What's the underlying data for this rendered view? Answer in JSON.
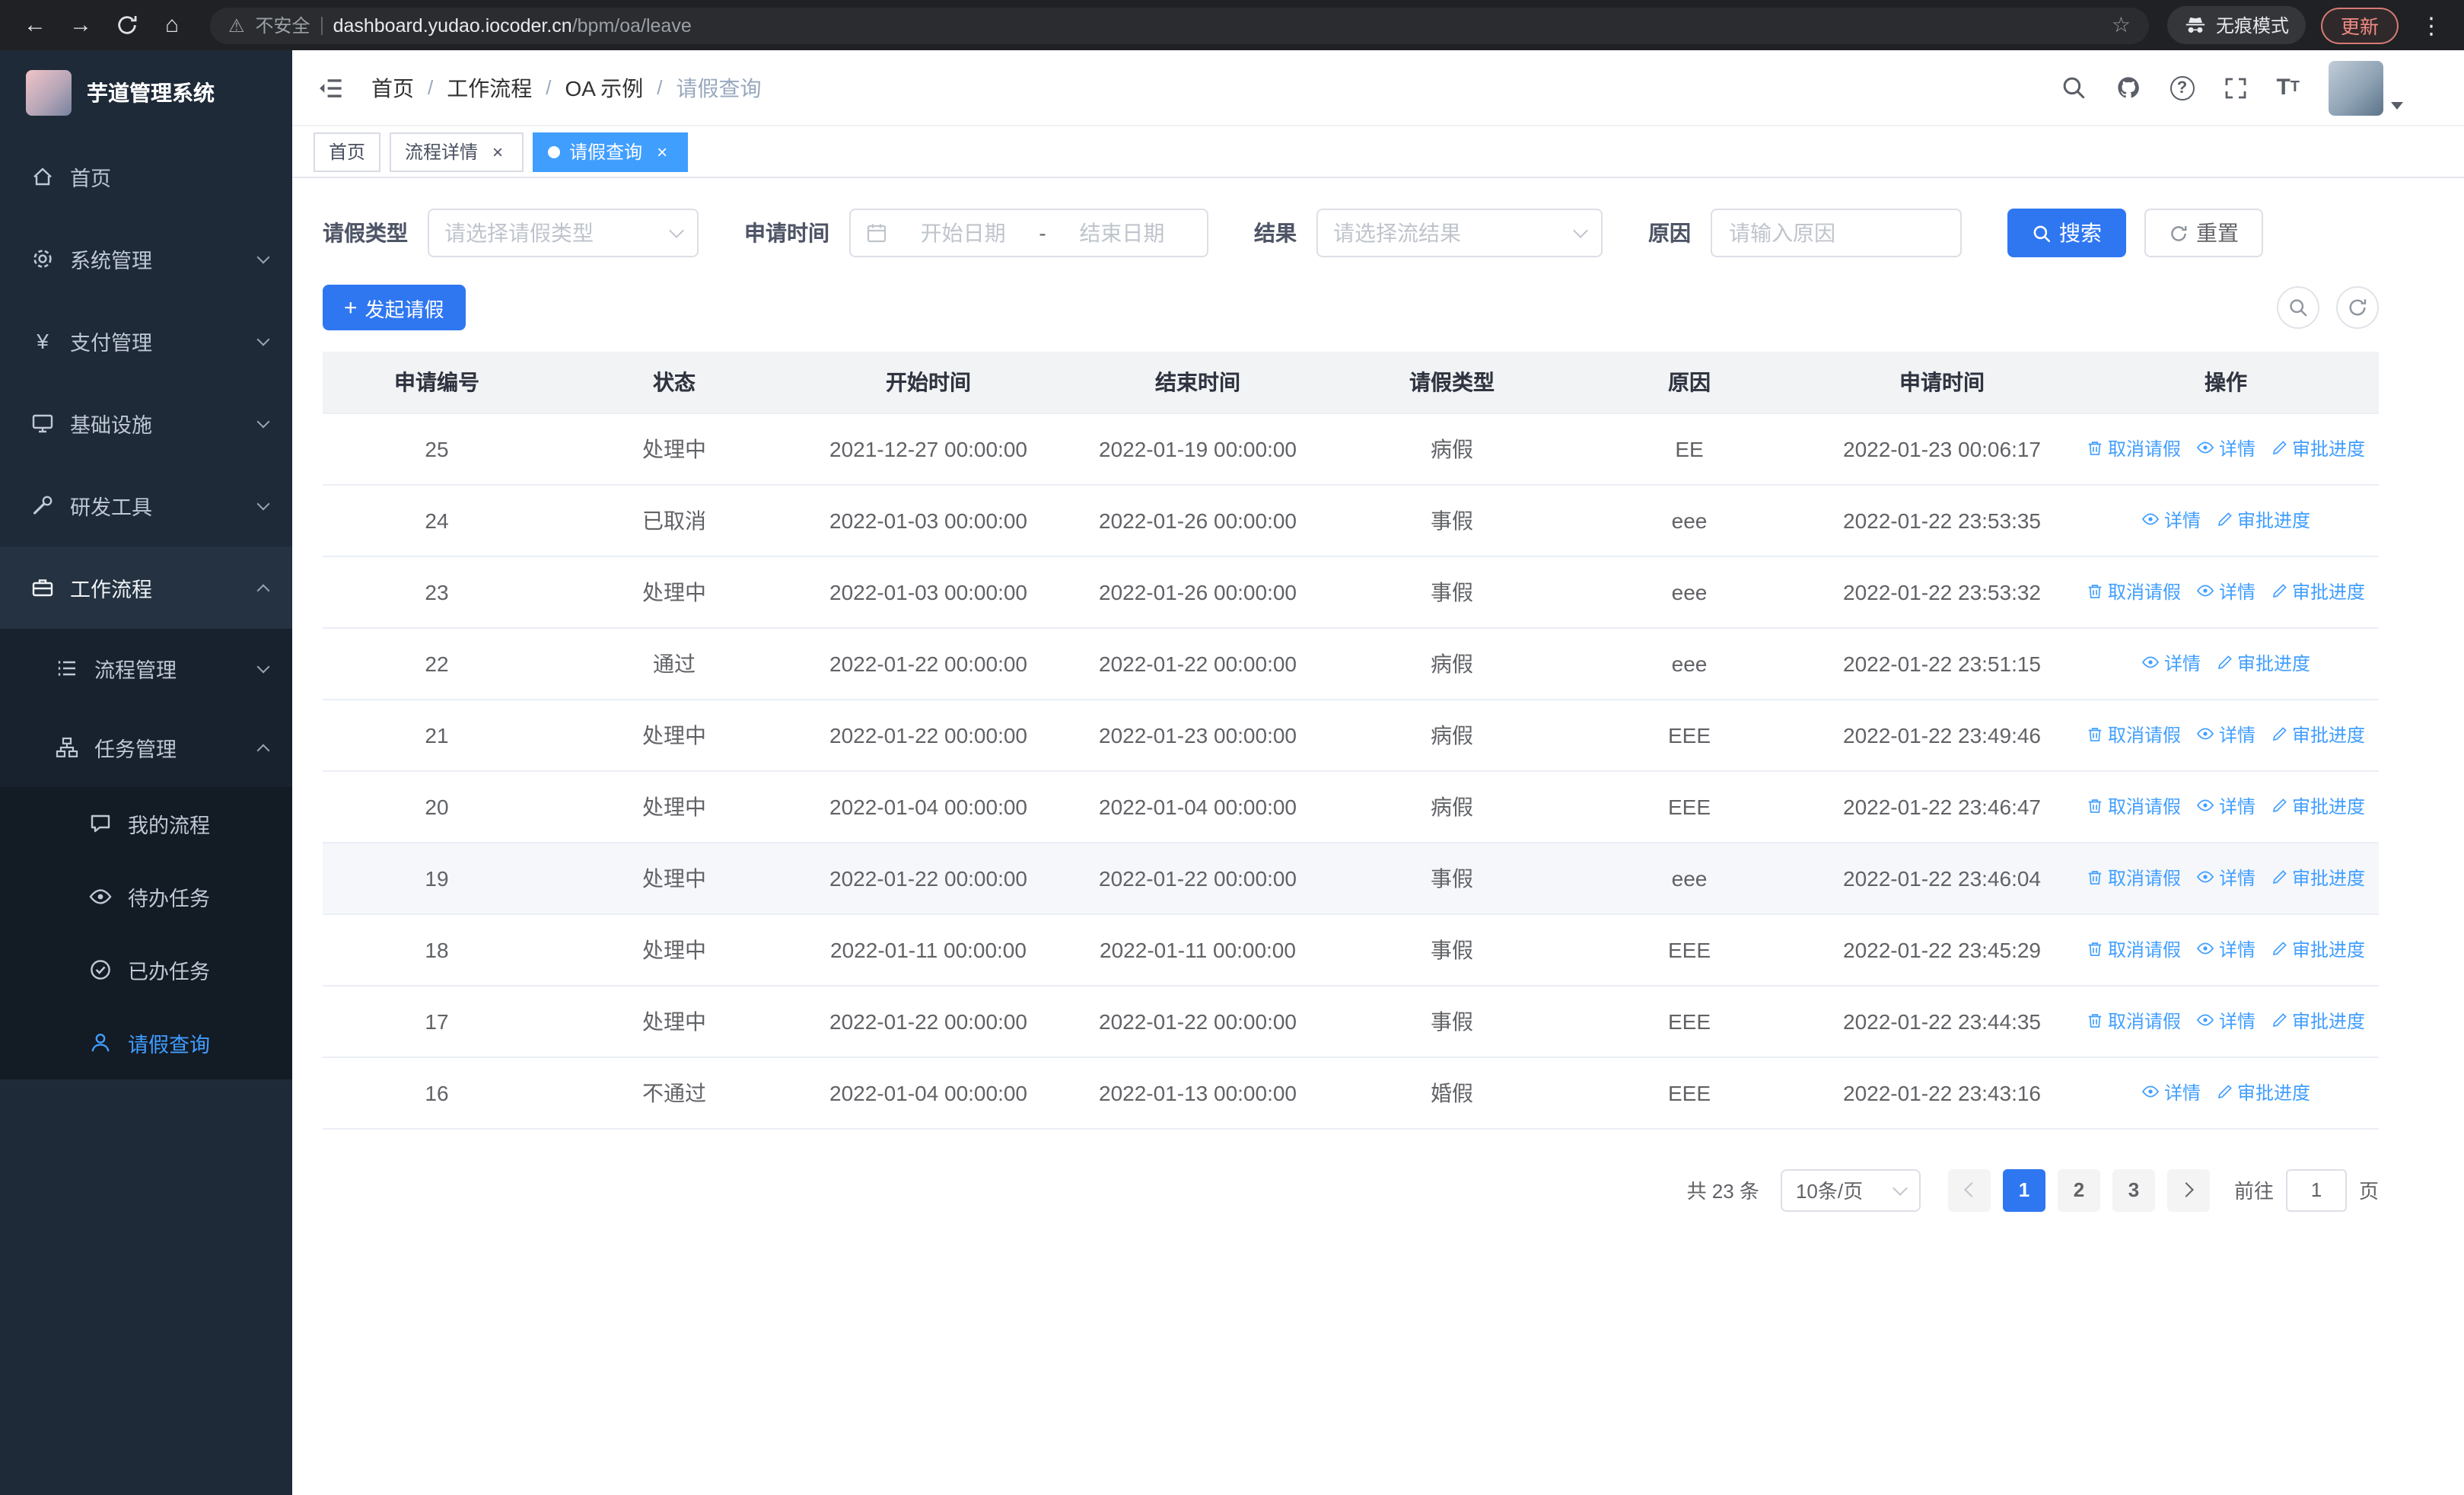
{
  "colors": {
    "primary_link": "#409eff",
    "primary_button": "#2f77f1",
    "sidebar_bg": "#1e2a38",
    "chrome_bg": "#202124",
    "update_red": "#f28b82",
    "table_header_bg": "#f2f3f5"
  },
  "browser": {
    "security_label": "不安全",
    "url_domain": "dashboard.yudao.iocoder.cn",
    "url_path": "/bpm/oa/leave",
    "incognito_label": "无痕模式",
    "update_label": "更新"
  },
  "sidebar": {
    "app_title": "芋道管理系统",
    "items": [
      {
        "label": "首页",
        "icon": "home-icon"
      },
      {
        "label": "系统管理",
        "icon": "gear-icon"
      },
      {
        "label": "支付管理",
        "icon": "yen-icon"
      },
      {
        "label": "基础设施",
        "icon": "monitor-icon"
      },
      {
        "label": "研发工具",
        "icon": "tools-icon"
      },
      {
        "label": "工作流程",
        "icon": "briefcase-icon",
        "expanded": true
      }
    ],
    "workflow_children": [
      {
        "label": "流程管理",
        "icon": "list-icon"
      },
      {
        "label": "任务管理",
        "icon": "org-chart-icon",
        "expanded": true
      }
    ],
    "task_children": [
      {
        "label": "我的流程",
        "icon": "chat-icon"
      },
      {
        "label": "待办任务",
        "icon": "eye-icon"
      },
      {
        "label": "已办任务",
        "icon": "check-circle-icon"
      },
      {
        "label": "请假查询",
        "icon": "user-icon",
        "active": true
      }
    ]
  },
  "header": {
    "breadcrumb": [
      "首页",
      "工作流程",
      "OA 示例",
      "请假查询"
    ]
  },
  "tabs": [
    {
      "label": "首页",
      "closable": false,
      "active": false
    },
    {
      "label": "流程详情",
      "closable": true,
      "active": false
    },
    {
      "label": "请假查询",
      "closable": true,
      "active": true
    }
  ],
  "filters": {
    "leave_type_label": "请假类型",
    "leave_type_placeholder": "请选择请假类型",
    "apply_time_label": "申请时间",
    "date_start_placeholder": "开始日期",
    "date_separator": "-",
    "date_end_placeholder": "结束日期",
    "result_label": "结果",
    "result_placeholder": "请选择流结果",
    "reason_label": "原因",
    "reason_placeholder": "请输入原因",
    "search_label": "搜索",
    "reset_label": "重置"
  },
  "toolbar": {
    "create_label": "发起请假"
  },
  "table": {
    "columns": [
      "申请编号",
      "状态",
      "开始时间",
      "结束时间",
      "请假类型",
      "原因",
      "申请时间",
      "操作"
    ],
    "action_labels": {
      "cancel": "取消请假",
      "detail": "详情",
      "progress": "审批进度"
    },
    "rows": [
      {
        "id": "25",
        "status": "处理中",
        "start": "2021-12-27 00:00:00",
        "end": "2022-01-19 00:00:00",
        "type": "病假",
        "reason": "EE",
        "applied": "2022-01-23 00:06:17",
        "actions": [
          "cancel",
          "detail",
          "progress"
        ]
      },
      {
        "id": "24",
        "status": "已取消",
        "start": "2022-01-03 00:00:00",
        "end": "2022-01-26 00:00:00",
        "type": "事假",
        "reason": "eee",
        "applied": "2022-01-22 23:53:35",
        "actions": [
          "detail",
          "progress"
        ]
      },
      {
        "id": "23",
        "status": "处理中",
        "start": "2022-01-03 00:00:00",
        "end": "2022-01-26 00:00:00",
        "type": "事假",
        "reason": "eee",
        "applied": "2022-01-22 23:53:32",
        "actions": [
          "cancel",
          "detail",
          "progress"
        ]
      },
      {
        "id": "22",
        "status": "通过",
        "start": "2022-01-22 00:00:00",
        "end": "2022-01-22 00:00:00",
        "type": "病假",
        "reason": "eee",
        "applied": "2022-01-22 23:51:15",
        "actions": [
          "detail",
          "progress"
        ]
      },
      {
        "id": "21",
        "status": "处理中",
        "start": "2022-01-22 00:00:00",
        "end": "2022-01-23 00:00:00",
        "type": "病假",
        "reason": "EEE",
        "applied": "2022-01-22 23:49:46",
        "actions": [
          "cancel",
          "detail",
          "progress"
        ]
      },
      {
        "id": "20",
        "status": "处理中",
        "start": "2022-01-04 00:00:00",
        "end": "2022-01-04 00:00:00",
        "type": "病假",
        "reason": "EEE",
        "applied": "2022-01-22 23:46:47",
        "actions": [
          "cancel",
          "detail",
          "progress"
        ]
      },
      {
        "id": "19",
        "status": "处理中",
        "start": "2022-01-22 00:00:00",
        "end": "2022-01-22 00:00:00",
        "type": "事假",
        "reason": "eee",
        "applied": "2022-01-22 23:46:04",
        "actions": [
          "cancel",
          "detail",
          "progress"
        ],
        "highlighted": true
      },
      {
        "id": "18",
        "status": "处理中",
        "start": "2022-01-11 00:00:00",
        "end": "2022-01-11 00:00:00",
        "type": "事假",
        "reason": "EEE",
        "applied": "2022-01-22 23:45:29",
        "actions": [
          "cancel",
          "detail",
          "progress"
        ]
      },
      {
        "id": "17",
        "status": "处理中",
        "start": "2022-01-22 00:00:00",
        "end": "2022-01-22 00:00:00",
        "type": "事假",
        "reason": "EEE",
        "applied": "2022-01-22 23:44:35",
        "actions": [
          "cancel",
          "detail",
          "progress"
        ]
      },
      {
        "id": "16",
        "status": "不通过",
        "start": "2022-01-04 00:00:00",
        "end": "2022-01-13 00:00:00",
        "type": "婚假",
        "reason": "EEE",
        "applied": "2022-01-22 23:43:16",
        "actions": [
          "detail",
          "progress"
        ]
      }
    ]
  },
  "pagination": {
    "total_label": "共 23 条",
    "page_size": "10条/页",
    "pages": [
      "1",
      "2",
      "3"
    ],
    "current_page": "1",
    "goto_label": "前往",
    "goto_value": "1",
    "goto_suffix": "页"
  }
}
